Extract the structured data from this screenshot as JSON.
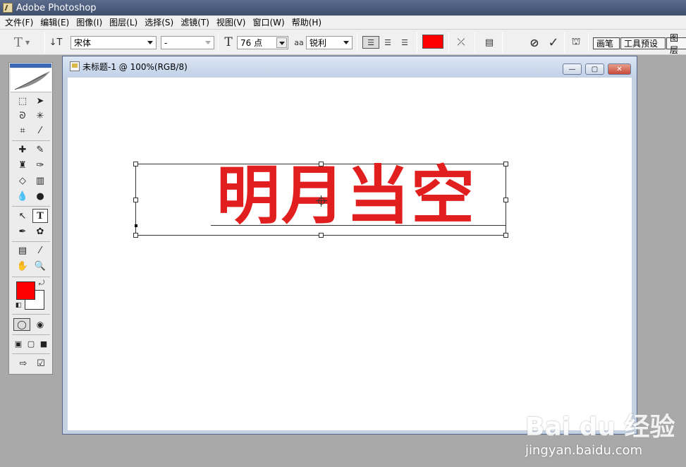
{
  "app": {
    "title": "Adobe Photoshop"
  },
  "menu": [
    "文件(F)",
    "编辑(E)",
    "图像(I)",
    "图层(L)",
    "选择(S)",
    "滤镜(T)",
    "视图(V)",
    "窗口(W)",
    "帮助(H)"
  ],
  "options": {
    "tool_preset_label": "T",
    "font_family": "宋体",
    "font_style": "-",
    "font_size": "76 点",
    "antialias_label": "aa",
    "antialias": "锐利",
    "text_color": "#ff0000",
    "cancel_icon": "cancel-icon",
    "commit_icon": "commit-checkmark-icon",
    "tabs": [
      "画笔",
      "工具预设",
      "图层"
    ]
  },
  "document": {
    "title": "未标题-1 @ 100%(RGB/8)",
    "text_content": "明月当空",
    "text_color": "#e11f1f"
  },
  "tools": {
    "foreground_color": "#ff0000",
    "background_color": "#ffffff"
  },
  "watermark": {
    "logo": "Bai du 经验",
    "url": "jingyan.baidu.com"
  }
}
